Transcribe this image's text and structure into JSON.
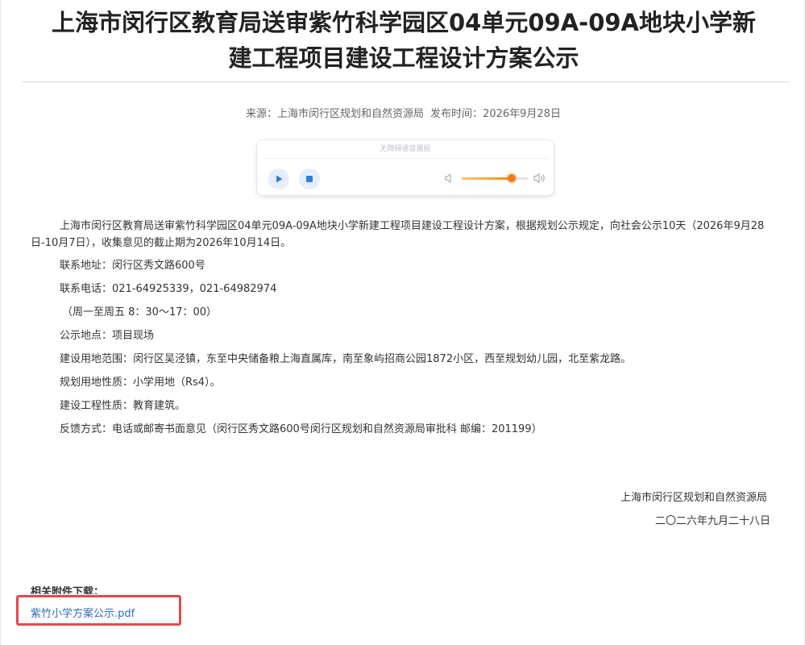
{
  "article": {
    "title_line1": "上海市闵行区教育局送审紫竹科学园区04单元09A-09A地块小学新",
    "title_line2": "建工程项目建设工程设计方案公示",
    "source_label": "来源：",
    "source": "上海市闵行区规划和自然资源局",
    "publish_label": "发布时间：",
    "publish_date": "2026年9月28日"
  },
  "player": {
    "label": "无障碍语音播报",
    "volume_percent": 75,
    "accent_color": "#f37b12",
    "play_icon": "play-icon",
    "stop_icon": "stop-icon"
  },
  "body": {
    "intro": "上海市闵行区教育局送审紫竹科学园区04单元09A-09A地块小学新建工程项目建设工程设计方案，根据规划公示规定，向社会公示10天（2026年9月28日-10月7日），收集意见的截止期为2026年10月14日。",
    "lines": [
      "联系地址：闵行区秀文路600号",
      "联系电话：021-64925339，021-64982974",
      "（周一至周五 8：30～17：00）",
      "公示地点：项目现场",
      "建设用地范围：闵行区吴泾镇，东至中央储备粮上海直属库，南至象屿招商公园1872小区，西至规划幼儿园，北至紫龙路。",
      "规划用地性质：小学用地（Rs4）。",
      "建设工程性质：教育建筑。",
      "反馈方式：电话或邮寄书面意见（闵行区秀文路600号闵行区规划和自然资源局审批科  邮编：201199）"
    ]
  },
  "signature": {
    "org": "上海市闵行区规划和自然资源局",
    "date": "二〇二六年九月二十八日"
  },
  "attachments": {
    "label": "相关附件下载：",
    "files": [
      "紫竹小学方案公示.pdf"
    ],
    "highlight_color": "#e24a4a"
  }
}
